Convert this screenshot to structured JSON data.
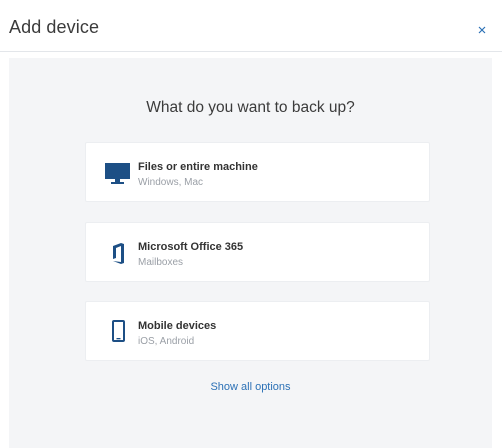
{
  "dialog": {
    "title": "Add device",
    "close_symbol": "×"
  },
  "body": {
    "question": "What do you want to back up?",
    "options": [
      {
        "title": "Files or entire machine",
        "subtitle": "Windows, Mac",
        "icon": "desktop-monitor-icon"
      },
      {
        "title": "Microsoft Office 365",
        "subtitle": "Mailboxes",
        "icon": "office-365-icon"
      },
      {
        "title": "Mobile devices",
        "subtitle": "iOS, Android",
        "icon": "mobile-phone-icon"
      }
    ],
    "show_all_label": "Show all options"
  },
  "colors": {
    "accent": "#2c71b6",
    "icon": "#1d4f85",
    "body_background": "#f4f5f7"
  }
}
